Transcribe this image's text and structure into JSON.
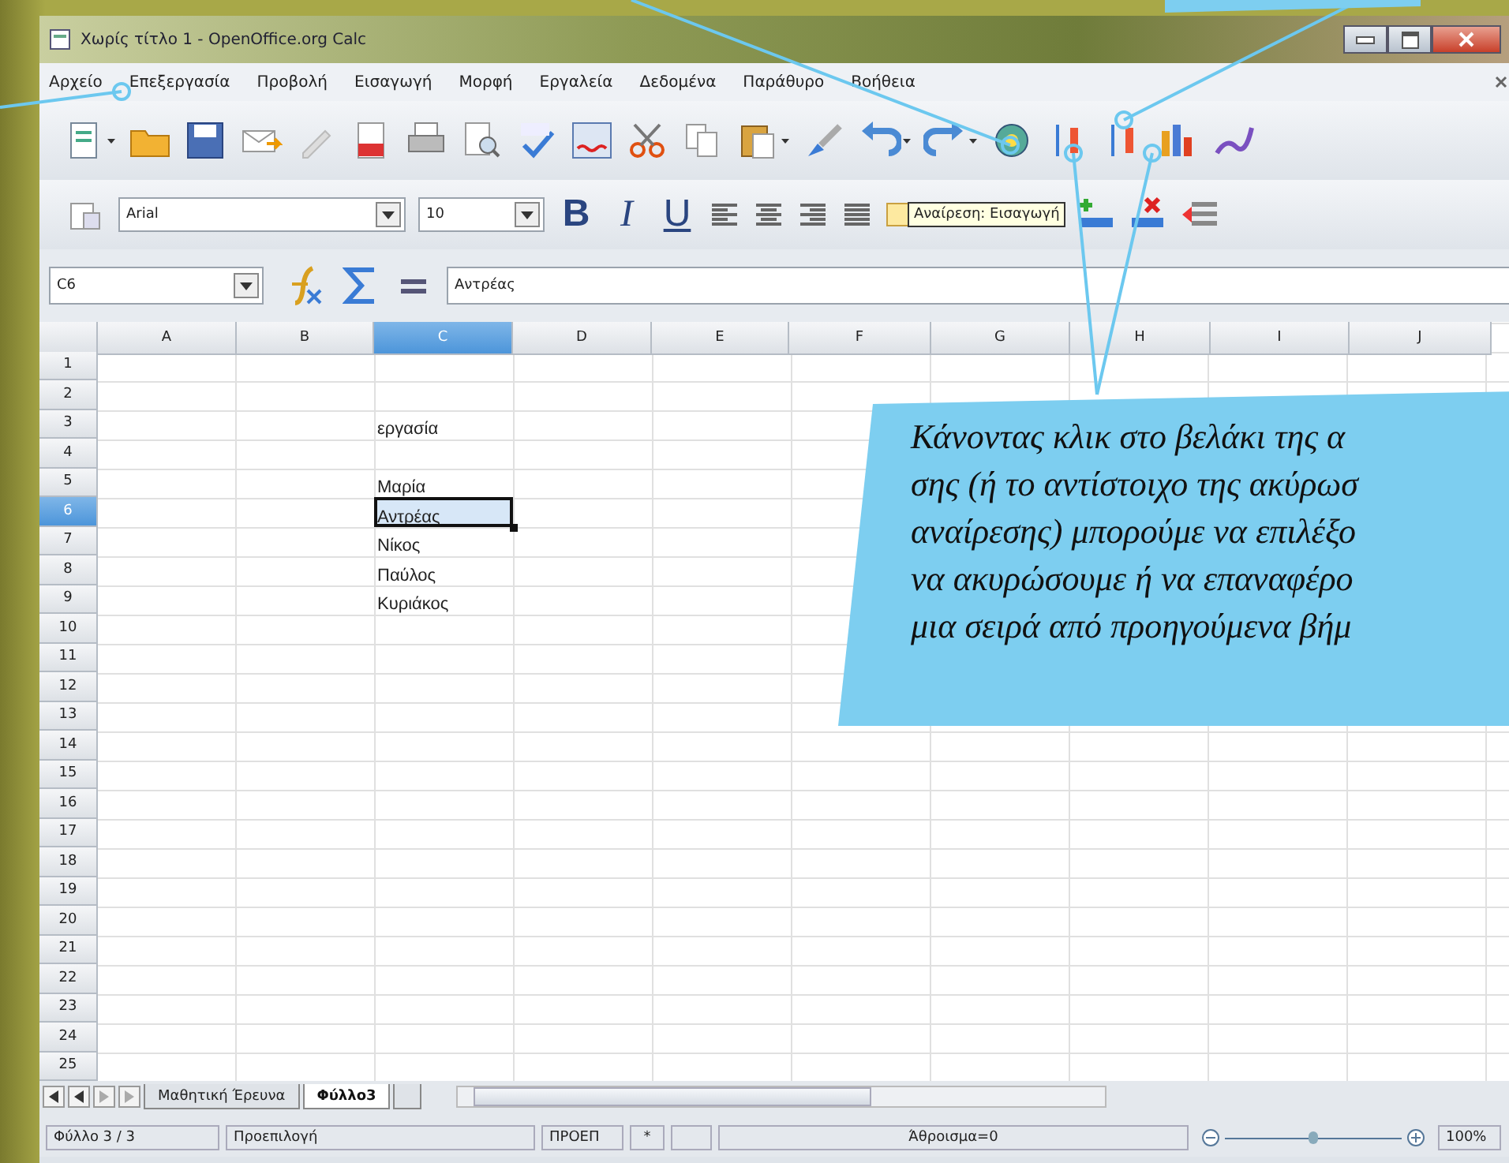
{
  "window": {
    "title": "Χωρίς τίτλο 1 - OpenOffice.org Calc"
  },
  "menu": [
    "Αρχείο",
    "Επεξεργασία",
    "Προβολή",
    "Εισαγωγή",
    "Μορφή",
    "Εργαλεία",
    "Δεδομένα",
    "Παράθυρο",
    "Βοήθεια"
  ],
  "formatting": {
    "font": "Arial",
    "size": "10",
    "style_buttons": [
      {
        "kind": "bold",
        "label": "B"
      },
      {
        "kind": "italic",
        "label": "I"
      },
      {
        "kind": "underline",
        "label": "U"
      }
    ]
  },
  "zoom": {
    "level": 0.5
  },
  "tooltip": "Αναίρεση: Εισαγωγή",
  "formula_bar": {
    "cell": "C6",
    "value": "Αντρέας"
  },
  "columns": [
    {
      "label": "A",
      "selected": false
    },
    {
      "label": "B",
      "selected": false
    },
    {
      "label": "C",
      "selected": true
    },
    {
      "label": "D",
      "selected": false
    },
    {
      "label": "E",
      "selected": false
    },
    {
      "label": "F",
      "selected": false
    },
    {
      "label": "G",
      "selected": false
    },
    {
      "label": "H",
      "selected": false
    },
    {
      "label": "I",
      "selected": false
    },
    {
      "label": "J",
      "selected": false
    }
  ],
  "rows": [
    {
      "label": "1",
      "selected": false
    },
    {
      "label": "2",
      "selected": false
    },
    {
      "label": "3",
      "selected": false,
      "cells": {
        "2": "εργασία"
      }
    },
    {
      "label": "4",
      "selected": false
    },
    {
      "label": "5",
      "selected": false,
      "cells": {
        "2": "Μαρία"
      }
    },
    {
      "label": "6",
      "selected": true,
      "cells": {
        "2": "Αντρέας"
      }
    },
    {
      "label": "7",
      "selected": false,
      "cells": {
        "2": "Νίκος"
      }
    },
    {
      "label": "8",
      "selected": false,
      "cells": {
        "2": "Παύλος"
      }
    },
    {
      "label": "9",
      "selected": false,
      "cells": {
        "2": "Κυριάκος"
      }
    },
    {
      "label": "10",
      "selected": false
    },
    {
      "label": "11",
      "selected": false
    },
    {
      "label": "12",
      "selected": false
    },
    {
      "label": "13",
      "selected": false
    },
    {
      "label": "14",
      "selected": false
    },
    {
      "label": "15",
      "selected": false
    },
    {
      "label": "16",
      "selected": false
    },
    {
      "label": "17",
      "selected": false
    },
    {
      "label": "18",
      "selected": false
    },
    {
      "label": "19",
      "selected": false
    },
    {
      "label": "20",
      "selected": false
    },
    {
      "label": "21",
      "selected": false
    },
    {
      "label": "22",
      "selected": false
    },
    {
      "label": "23",
      "selected": false
    },
    {
      "label": "24",
      "selected": false
    },
    {
      "label": "25",
      "selected": false
    }
  ],
  "sheet_tabs": [
    {
      "label": "Μαθητική Έρευνα",
      "selected": false
    },
    {
      "label": "Φύλλο3",
      "selected": true
    }
  ],
  "status_bar": [
    "Φύλλο 3 / 3",
    "Προεπιλογή",
    "ΠΡΟΕΠ",
    "*",
    "Άθροισμα=0",
    "100%"
  ],
  "callout": {
    "lines": [
      "Κάνοντας κλικ στο βελάκι της α",
      "σης (ή το αντίστοιχο της ακύρωσ",
      "αναίρεσης) μπορούμε να επιλέξο",
      "να ακυρώσουμε ή να επαναφέρο",
      "μια σειρά από προηγούμενα βήμ"
    ]
  }
}
